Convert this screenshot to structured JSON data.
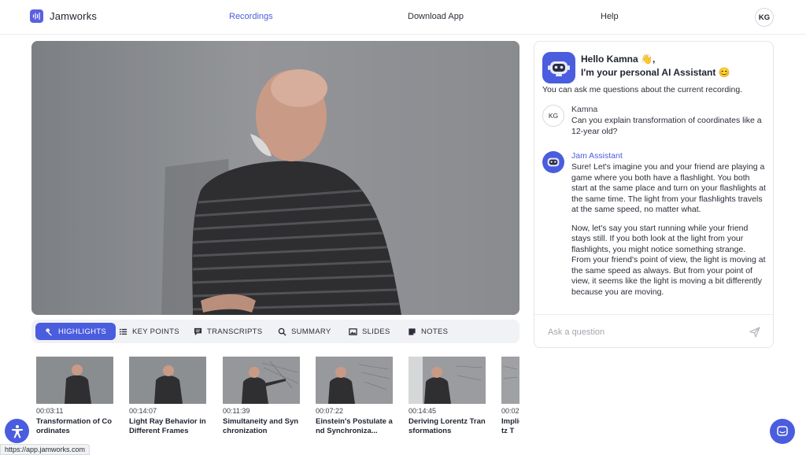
{
  "brand": {
    "name": "Jamworks"
  },
  "nav": {
    "items": [
      {
        "label": "Recordings",
        "active": true
      },
      {
        "label": "Download App",
        "active": false
      },
      {
        "label": "Help",
        "active": false
      }
    ],
    "user_initials": "KG"
  },
  "tabs": [
    {
      "label": "HIGHLIGHTS",
      "icon": "highlights-icon",
      "active": true
    },
    {
      "label": "KEY POINTS",
      "icon": "list-icon",
      "active": false
    },
    {
      "label": "TRANSCRIPTS",
      "icon": "transcript-icon",
      "active": false
    },
    {
      "label": "SUMMARY",
      "icon": "search-icon",
      "active": false
    },
    {
      "label": "SLIDES",
      "icon": "image-icon",
      "active": false
    },
    {
      "label": "NOTES",
      "icon": "notes-icon",
      "active": false
    }
  ],
  "highlights": [
    {
      "time": "00:03:11",
      "title": "Transformation of Coordinates"
    },
    {
      "time": "00:14:07",
      "title": "Light Ray Behavior in Different Frames"
    },
    {
      "time": "00:11:39",
      "title": "Simultaneity and Synchronization"
    },
    {
      "time": "00:07:22",
      "title": "Einstein's Postulate and Synchroniza..."
    },
    {
      "time": "00:14:45",
      "title": "Deriving Lorentz Transformations"
    },
    {
      "time": "00:02",
      "title": "Implications of Lorentz T"
    }
  ],
  "assistant": {
    "greeting_line1": "Hello Kamna 👋,",
    "greeting_line2": "I'm your personal AI Assistant 😊",
    "intro": "You can ask me questions about the current recording.",
    "messages": [
      {
        "sender": "Kamna",
        "initials": "KG",
        "text": "Can you explain transformation of coordinates like a 12-year old?"
      },
      {
        "sender": "Jam Assistant",
        "paragraph1": "Sure! Let's imagine you and your friend are playing a game where you both have a flashlight. You both start at the same place and turn on your flashlights at the same time. The light from your flashlights travels at the same speed, no matter what.",
        "paragraph2": "Now, let's say you start running while your friend stays still. If you both look at the light from your flashlights, you might notice something strange. From your friend's point of view, the light is moving at the same speed as always. But from your point of view, it seems like the light is moving a bit differently because you are moving."
      }
    ],
    "input_placeholder": "Ask a question"
  },
  "status_url": "https://app.jamworks.com",
  "colors": {
    "accent": "#4a5ddf"
  }
}
